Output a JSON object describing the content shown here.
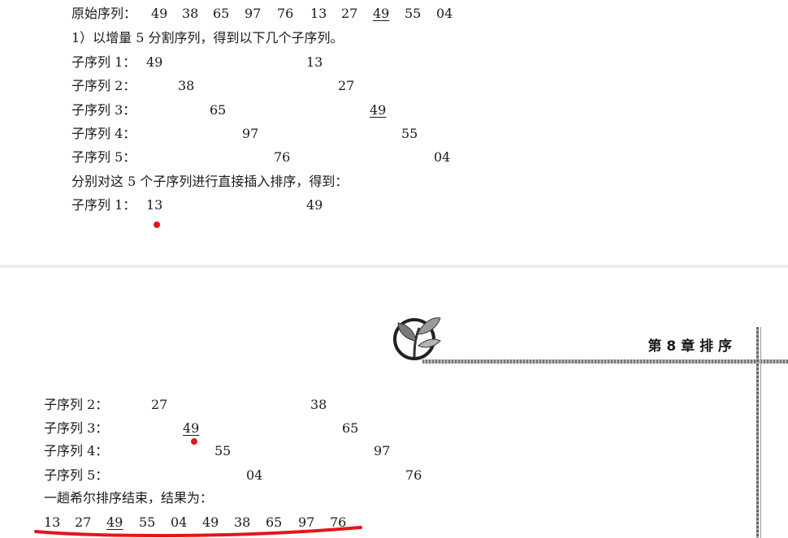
{
  "top": {
    "original_label": "原始序列：",
    "original": [
      "49",
      "38",
      "65",
      "97",
      "76",
      "13",
      "27",
      "49",
      "55",
      "04"
    ],
    "step1": "1）以增量 5 分割序列，得到以下几个子序列。",
    "subseqs": [
      {
        "label": "子序列 1：",
        "a": "49",
        "b": "13"
      },
      {
        "label": "子序列 2：",
        "a": "38",
        "b": "27"
      },
      {
        "label": "子序列 3：",
        "a": "65",
        "b": "49"
      },
      {
        "label": "子序列 4：",
        "a": "97",
        "b": "55"
      },
      {
        "label": "子序列 5：",
        "a": "76",
        "b": "04"
      }
    ],
    "step2": "分别对这 5 个子序列进行直接插入排序，得到：",
    "sorted1": {
      "label": "子序列 1：",
      "a": "13",
      "b": "49"
    }
  },
  "header": {
    "chapter": "第 8 章    排    序"
  },
  "bottom": {
    "subseqs": [
      {
        "label": "子序列 2：",
        "a": "27",
        "b": "38"
      },
      {
        "label": "子序列 3：",
        "a": "49",
        "b": "65"
      },
      {
        "label": "子序列 4：",
        "a": "55",
        "b": "97"
      },
      {
        "label": "子序列 5：",
        "a": "04",
        "b": "76"
      }
    ],
    "result_text": "一趟希尔排序结束，结果为：",
    "result": [
      "13",
      "27",
      "49",
      "55",
      "04",
      "49",
      "38",
      "65",
      "97",
      "76"
    ]
  },
  "colors": {
    "annotation": "#e0181b"
  }
}
